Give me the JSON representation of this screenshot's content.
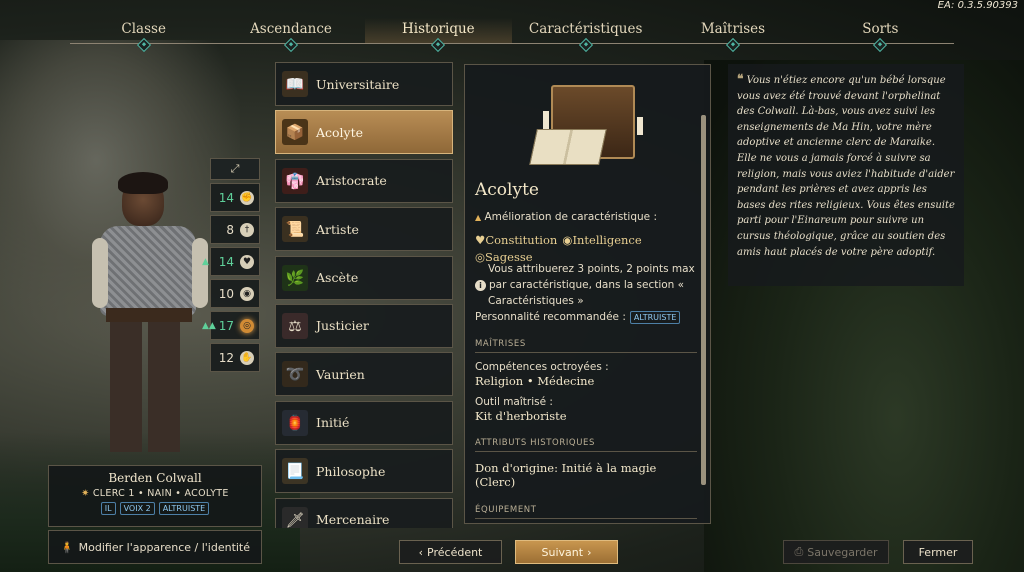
{
  "version": "EA: 0.3.5.90393",
  "tabs": [
    {
      "label": "Classe"
    },
    {
      "label": "Ascendance"
    },
    {
      "label": "Historique"
    },
    {
      "label": "Caractéristiques"
    },
    {
      "label": "Maîtrises"
    },
    {
      "label": "Sorts"
    }
  ],
  "active_tab": "Historique",
  "stats": [
    {
      "value": "14",
      "icon": "fist-icon",
      "bonus": false
    },
    {
      "value": "8",
      "icon": "dagger-icon",
      "bonus": false
    },
    {
      "value": "14",
      "icon": "heart-icon",
      "bonus": true
    },
    {
      "value": "10",
      "icon": "brain-icon",
      "bonus": false
    },
    {
      "value": "17",
      "icon": "eye-icon",
      "bonus": true,
      "double": true
    },
    {
      "value": "12",
      "icon": "hand-icon",
      "bonus": false
    }
  ],
  "character": {
    "name": "Berden Colwall",
    "subtitle": "CLERC 1 • NAIN • ACOLYTE",
    "tags": [
      "IL",
      "VOIX 2",
      "ALTRUISTE"
    ],
    "appearance_button": "Modifier l'apparence / l'identité"
  },
  "backgrounds": [
    {
      "label": "Universitaire",
      "icon": "book-icon"
    },
    {
      "label": "Acolyte",
      "icon": "altar-icon"
    },
    {
      "label": "Aristocrate",
      "icon": "robe-icon"
    },
    {
      "label": "Artiste",
      "icon": "scroll-icon"
    },
    {
      "label": "Ascète",
      "icon": "herb-icon"
    },
    {
      "label": "Justicier",
      "icon": "gavel-icon"
    },
    {
      "label": "Vaurien",
      "icon": "rope-icon"
    },
    {
      "label": "Initié",
      "icon": "lantern-icon"
    },
    {
      "label": "Philosophe",
      "icon": "parchment-icon"
    },
    {
      "label": "Mercenaire",
      "icon": "sword-icon"
    }
  ],
  "selected_background": "Acolyte",
  "detail": {
    "title": "Acolyte",
    "improvement_label": "Amélioration de caractéristique :",
    "attr1": "Constitution",
    "attr2": "Intelligence",
    "attr3": "Sagesse",
    "points_text_1": "Vous attribuerez 3 points, 2 points max",
    "points_text_2": "par caractéristique, dans la section «",
    "points_text_3": "Caractéristiques »",
    "personality_label": "Personnalité recommandée :",
    "personality_tag": "ALTRUISTE",
    "section_maitrises": "MAÎTRISES",
    "skills_label": "Compétences octroyées :",
    "skills_value": "Religion • Médecine",
    "tool_label": "Outil maîtrisé :",
    "tool_value": "Kit d'herboriste",
    "section_attributes": "ATTRIBUTS HISTORIQUES",
    "origin_gift": "Don d'origine: Initié à la magie",
    "origin_gift_2": "(Clerc)",
    "section_equipment": "ÉQUIPEMENT"
  },
  "lore": "Vous n'étiez encore qu'un bébé lorsque vous avez été trouvé devant l'orphelinat des Colwall. Là-bas, vous avez suivi les enseignements de Ma Hin, votre mère adoptive et ancienne clerc de Maraike. Elle ne vous a jamais forcé à suivre sa religion, mais vous aviez l'habitude d'aider pendant les prières et avez appris les bases des rites religieux. Vous êtes ensuite parti pour l'Einareum pour suivre un cursus théologique, grâce au soutien des amis haut placés de votre père adoptif.",
  "buttons": {
    "previous": "Précédent",
    "next": "Suivant",
    "save": "Sauvegarder",
    "close": "Fermer"
  },
  "colors": {
    "accent_gold": "#b88d55",
    "check_teal": "#4fb5a3",
    "bonus_green": "#5fd09a",
    "tag_blue": "#8fc8f0"
  }
}
